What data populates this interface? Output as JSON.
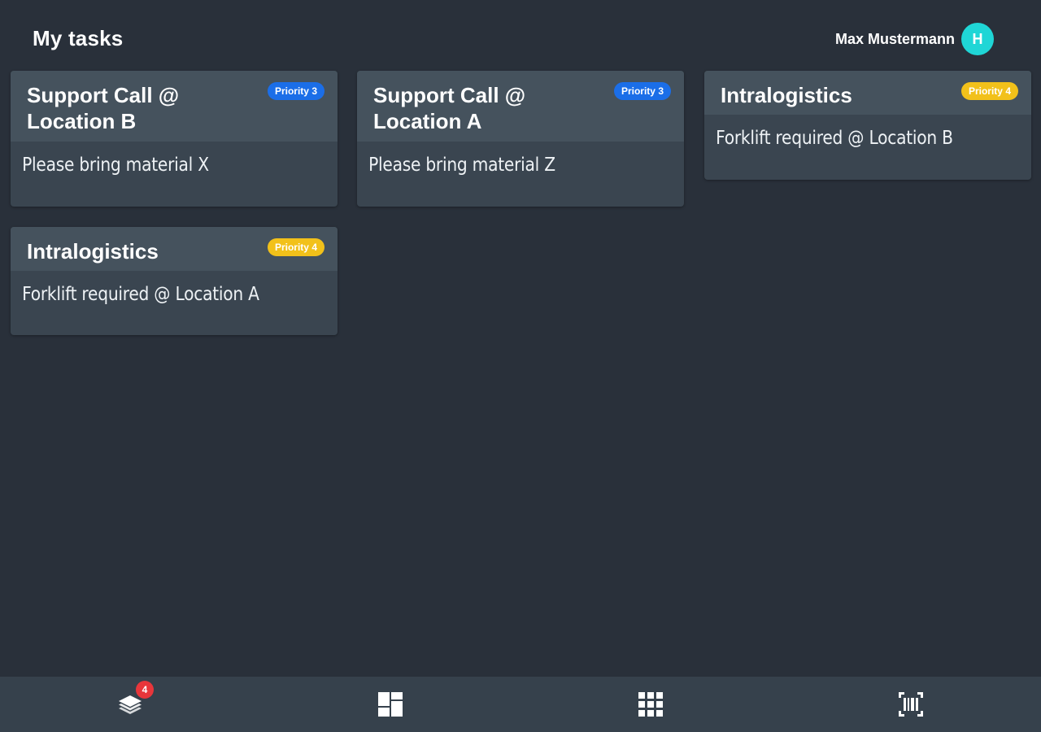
{
  "header": {
    "title": "My tasks",
    "user_name": "Max Mustermann",
    "avatar_initial": "H",
    "avatar_color": "#1fd6d6"
  },
  "tasks": [
    {
      "title_line1": "Support Call @",
      "title_line2": "Location B",
      "priority": "Priority 3",
      "description": "Please bring material X",
      "priority_color": "#1b6ee8"
    },
    {
      "title_line1": "Support Call @",
      "title_line2": "Location A",
      "priority": "Priority 3",
      "description": "Please bring material Z",
      "priority_color": "#1b6ee8"
    },
    {
      "title_line1": "Intralogistics",
      "title_line2": "",
      "priority": "Priority 4",
      "description": "Forklift required @ Location B",
      "priority_color": "#f2c11a"
    },
    {
      "title_line1": "Intralogistics",
      "title_line2": "",
      "priority": "Priority 4",
      "description": "Forklift required @ Location A",
      "priority_color": "#f2c11a"
    }
  ],
  "bottom_nav": {
    "items": [
      {
        "icon": "layers-icon",
        "badge": "4"
      },
      {
        "icon": "dashboard-icon"
      },
      {
        "icon": "apps-grid-icon"
      },
      {
        "icon": "barcode-scan-icon"
      }
    ],
    "badge_color": "#e8363b"
  },
  "colors": {
    "background": "#29303a",
    "card": "#3a4550",
    "card_header": "#45525d",
    "bottom_bar": "#36414c"
  }
}
